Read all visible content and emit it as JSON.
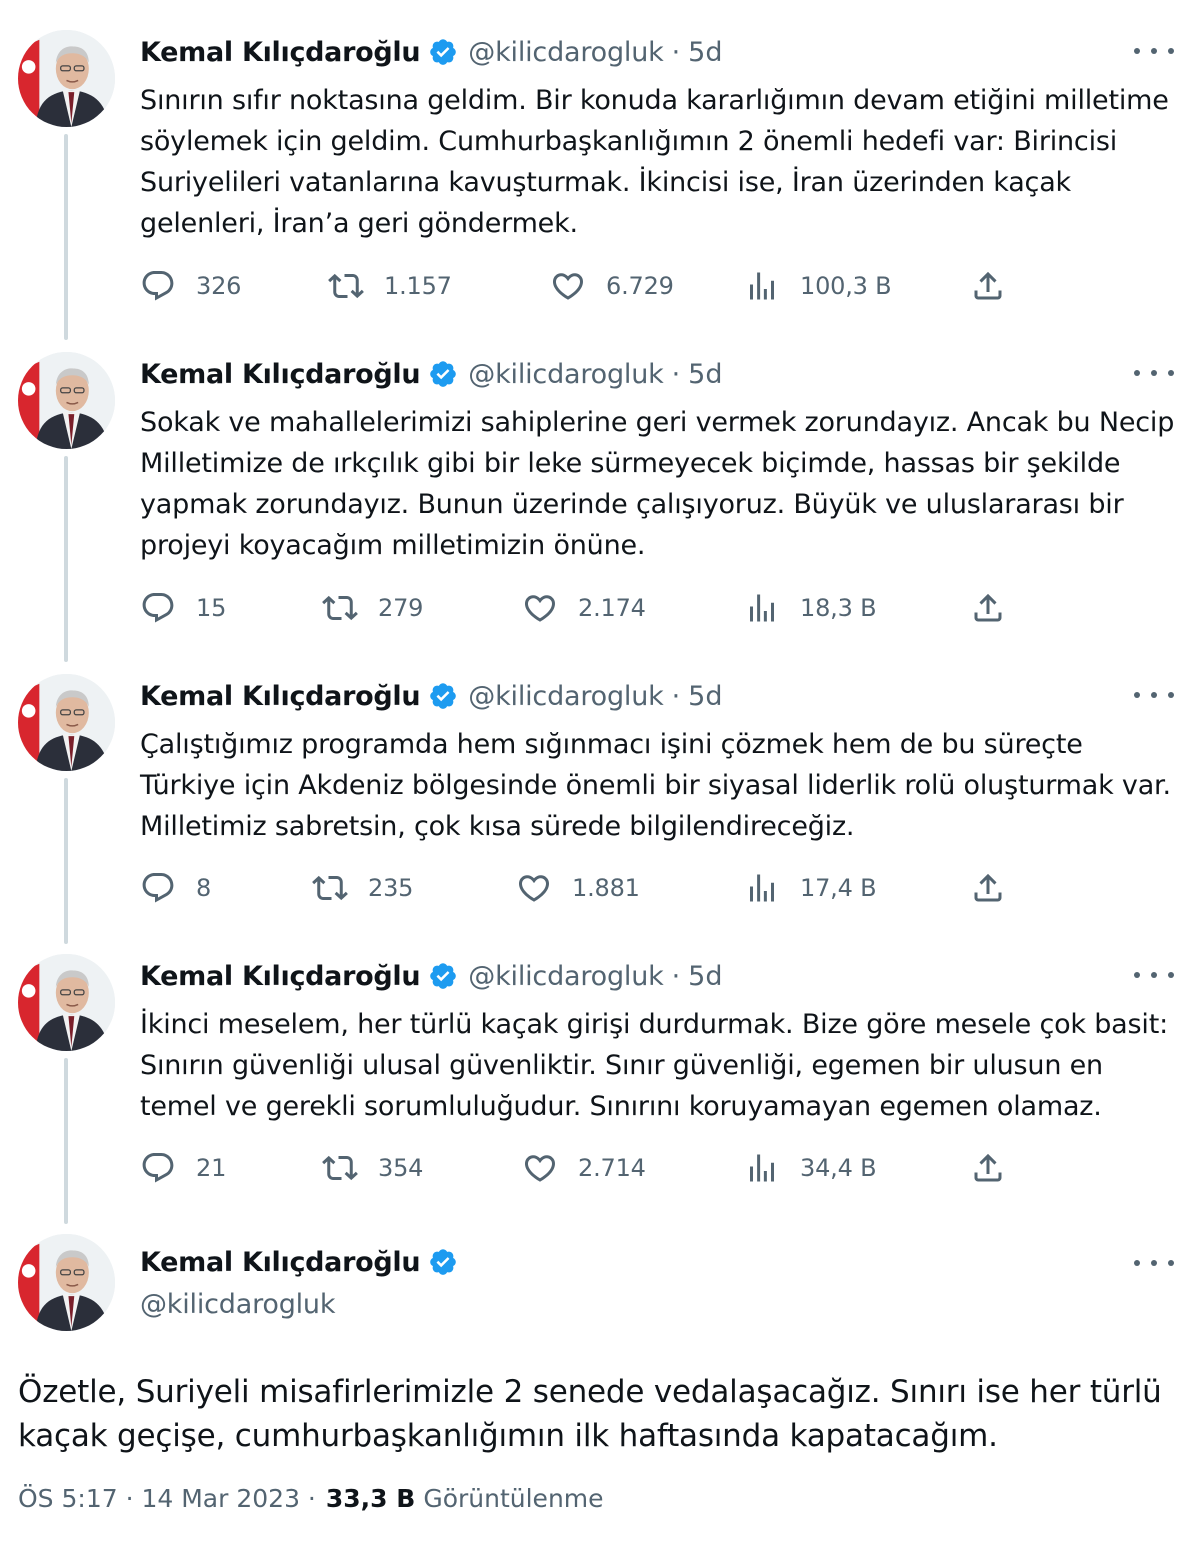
{
  "author": {
    "name": "Kemal Kılıçdaroğlu",
    "handle": "@kilicdarogluk"
  },
  "separator": "·",
  "tweets": [
    {
      "time": "5d",
      "text": "Sınırın sıfır noktasına geldim. Bir konuda kararlığımın devam etiğini milletime söylemek için geldim. Cumhurbaşkanlığımın 2 önemli hedefi var: Birincisi Suriyelileri vatanlarına kavuşturmak. İkincisi ise, İran üzerinden kaçak gelenleri, İran’a geri göndermek.",
      "replies": "326",
      "retweets": "1.157",
      "likes": "6.729",
      "views": "100,3 B"
    },
    {
      "time": "5d",
      "text": "Sokak ve mahallelerimizi sahiplerine geri vermek zorundayız. Ancak bu Necip Milletimize de ırkçılık gibi bir leke sürmeyecek biçimde, hassas bir şekilde yapmak zorundayız. Bunun üzerinde çalışıyoruz. Büyük ve uluslararası bir projeyi koyacağım milletimizin önüne.",
      "replies": "15",
      "retweets": "279",
      "likes": "2.174",
      "views": "18,3 B"
    },
    {
      "time": "5d",
      "text": "Çalıştığımız programda hem sığınmacı işini çözmek hem de bu süreçte Türkiye için Akdeniz bölgesinde önemli bir siyasal liderlik rolü oluşturmak var. Milletimiz sabretsin, çok kısa sürede bilgilendireceğiz.",
      "replies": "8",
      "retweets": "235",
      "likes": "1.881",
      "views": "17,4 B"
    },
    {
      "time": "5d",
      "text": "İkinci meselem, her türlü kaçak girişi durdurmak. Bize göre mesele çok basit: Sınırın güvenliği ulusal güvenliktir. Sınır güvenliği, egemen bir ulusun en temel ve gerekli sorumluluğudur. Sınırını koruyamayan egemen olamaz.",
      "replies": "21",
      "retweets": "354",
      "likes": "2.714",
      "views": "34,4 B"
    }
  ],
  "main_tweet": {
    "text": "Özetle, Suriyeli misafirlerimizle 2 senede vedalaşacağız. Sınırı ise her türlü kaçak geçişe, cumhurbaşkanlığımın ilk haftasında kapatacağım.",
    "timestamp": "ÖS 5:17 · 14 Mar 2023 ·",
    "views_count": "33,3 B",
    "views_label": "Görüntülenme"
  },
  "icons": {
    "verified": "verified-badge-icon",
    "reply": "reply-icon",
    "retweet": "retweet-icon",
    "like": "heart-icon",
    "views": "analytics-icon",
    "share": "share-icon",
    "more": "more-dots-icon"
  },
  "colors": {
    "verified_blue": "#1d9bf0",
    "secondary_text": "#536471",
    "thread_line": "#cfd9de",
    "primary_text": "#0f1419"
  }
}
